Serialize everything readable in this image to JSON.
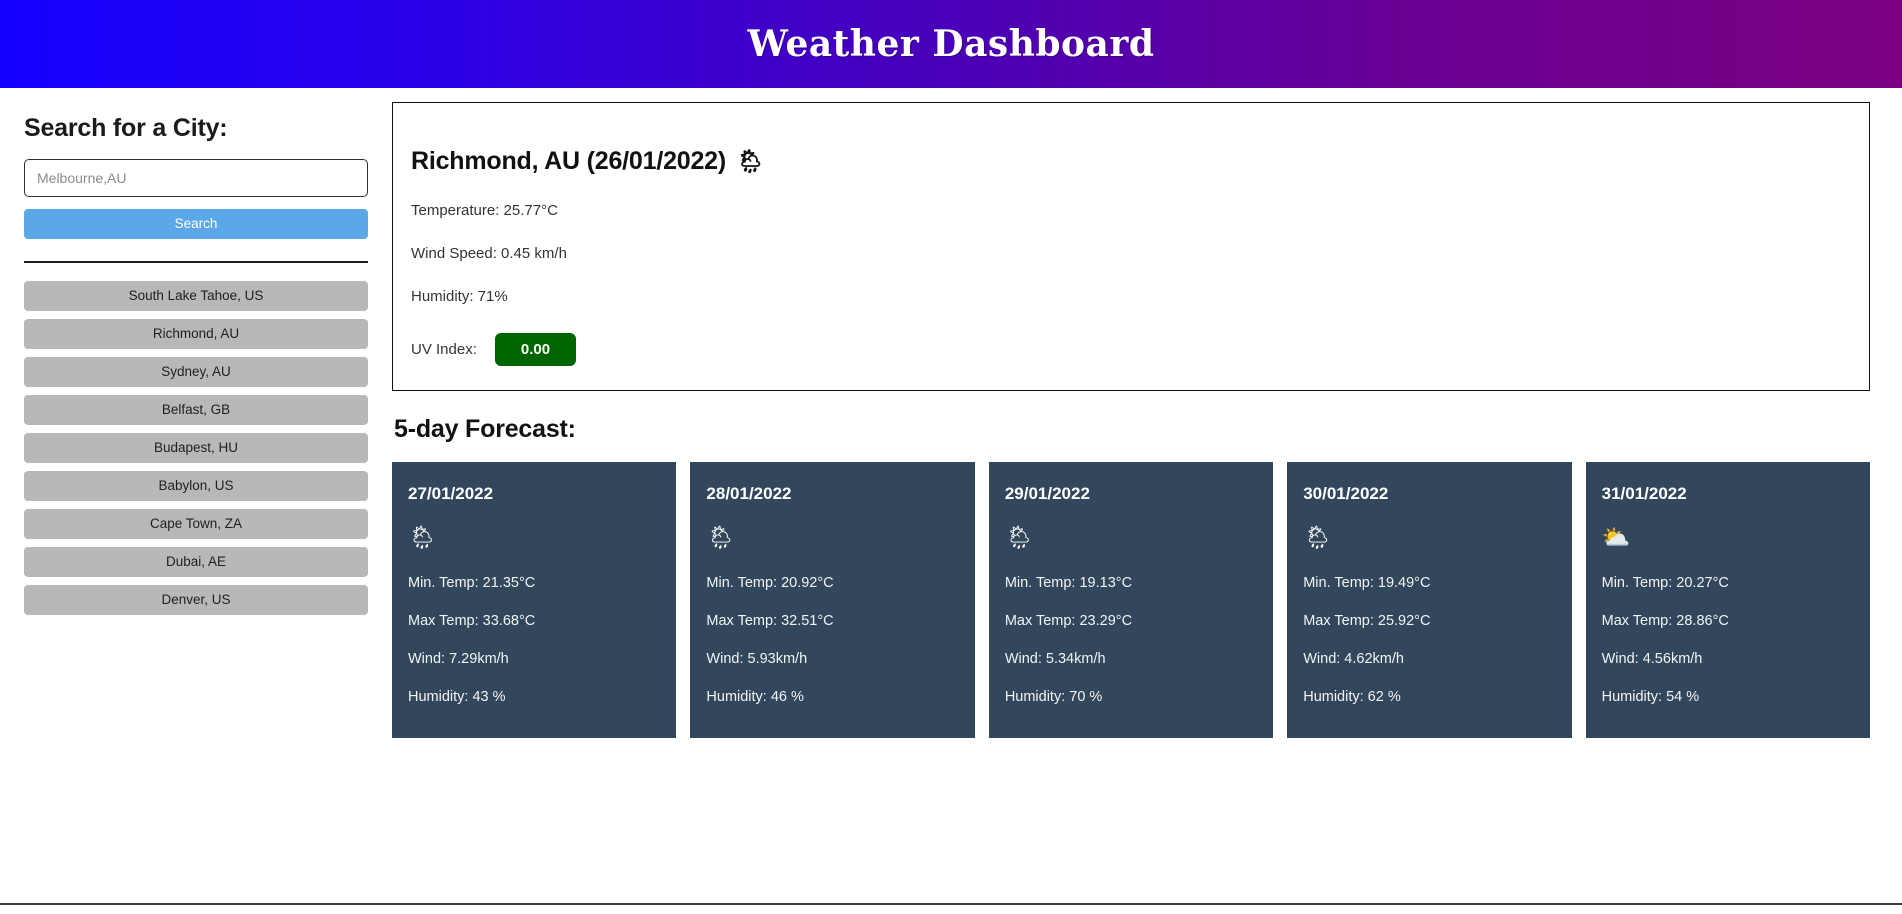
{
  "header": {
    "title": "Weather Dashboard",
    "gradient_start": "#1400ff",
    "gradient_end": "#7b0081"
  },
  "sidebar": {
    "heading": "Search for a City:",
    "search": {
      "placeholder": "Melbourne,AU",
      "value": "",
      "button_label": "Search",
      "button_color": "#5ba7e8"
    },
    "history": [
      {
        "label": "South Lake Tahoe, US"
      },
      {
        "label": "Richmond, AU"
      },
      {
        "label": "Sydney, AU"
      },
      {
        "label": "Belfast, GB"
      },
      {
        "label": "Budapest, HU"
      },
      {
        "label": "Babylon, US"
      },
      {
        "label": "Cape Town, ZA"
      },
      {
        "label": "Dubai, AE"
      },
      {
        "label": "Denver, US"
      }
    ]
  },
  "current": {
    "title": "Richmond, AU (26/01/2022)",
    "icon": "🌦",
    "icon_name": "rain-cloud-icon",
    "temperature": "Temperature: 25.77°C",
    "wind_speed": "Wind Speed: 0.45 km/h",
    "humidity": "Humidity: 71%",
    "uv_label": "UV Index:",
    "uv_value": "0.00",
    "uv_color": "#006400"
  },
  "forecast": {
    "heading": "5-day Forecast:",
    "card_color": "#32475b",
    "days": [
      {
        "date": "27/01/2022",
        "icon": "🌦",
        "icon_name": "sun-behind-rain-cloud-icon",
        "min_temp": "Min. Temp: 21.35°C",
        "max_temp": "Max Temp: 33.68°C",
        "wind": "Wind: 7.29km/h",
        "humidity": "Humidity: 43 %"
      },
      {
        "date": "28/01/2022",
        "icon": "🌦",
        "icon_name": "sun-behind-rain-cloud-icon",
        "min_temp": "Min. Temp: 20.92°C",
        "max_temp": "Max Temp: 32.51°C",
        "wind": "Wind: 5.93km/h",
        "humidity": "Humidity: 46 %"
      },
      {
        "date": "29/01/2022",
        "icon": "🌦",
        "icon_name": "sun-behind-rain-cloud-icon",
        "min_temp": "Min. Temp: 19.13°C",
        "max_temp": "Max Temp: 23.29°C",
        "wind": "Wind: 5.34km/h",
        "humidity": "Humidity: 70 %"
      },
      {
        "date": "30/01/2022",
        "icon": "🌦",
        "icon_name": "sun-behind-rain-cloud-icon",
        "min_temp": "Min. Temp: 19.49°C",
        "max_temp": "Max Temp: 25.92°C",
        "wind": "Wind: 4.62km/h",
        "humidity": "Humidity: 62 %"
      },
      {
        "date": "31/01/2022",
        "icon": "⛅",
        "icon_name": "sun-behind-cloud-icon",
        "min_temp": "Min. Temp: 20.27°C",
        "max_temp": "Max Temp: 28.86°C",
        "wind": "Wind: 4.56km/h",
        "humidity": "Humidity: 54 %"
      }
    ]
  }
}
